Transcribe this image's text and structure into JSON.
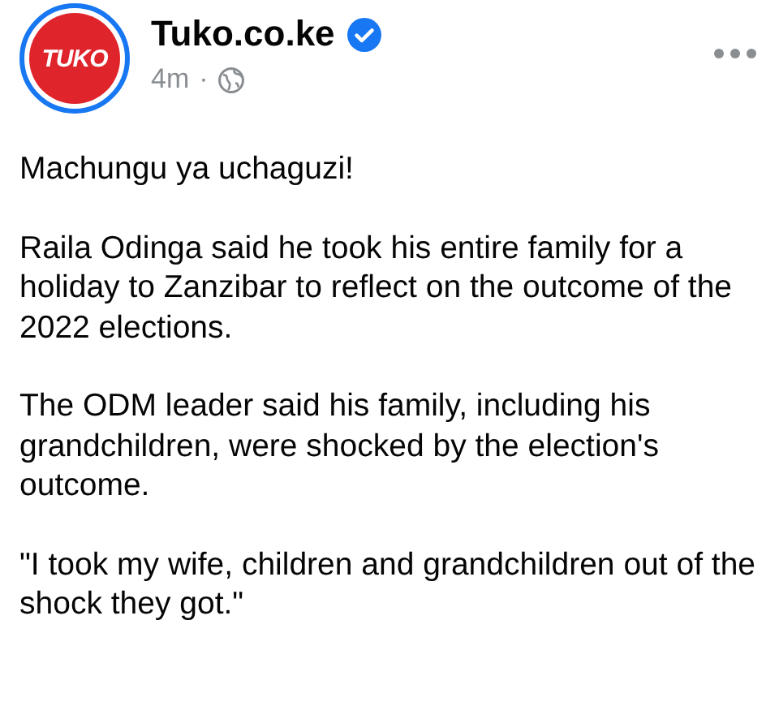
{
  "post": {
    "author": "Tuko.co.ke",
    "verified": true,
    "avatar_text": "TUKO",
    "time": "4m",
    "separator": "·",
    "paragraphs": [
      "Machungu ya uchaguzi!",
      "Raila Odinga said he took his entire family for a holiday to Zanzibar to reflect on the outcome of the 2022 elections.",
      "The ODM leader said his family, including his grandchildren, were shocked by the election's outcome.",
      "\"I took my wife, children and grandchildren out of the shock they got.\""
    ]
  }
}
